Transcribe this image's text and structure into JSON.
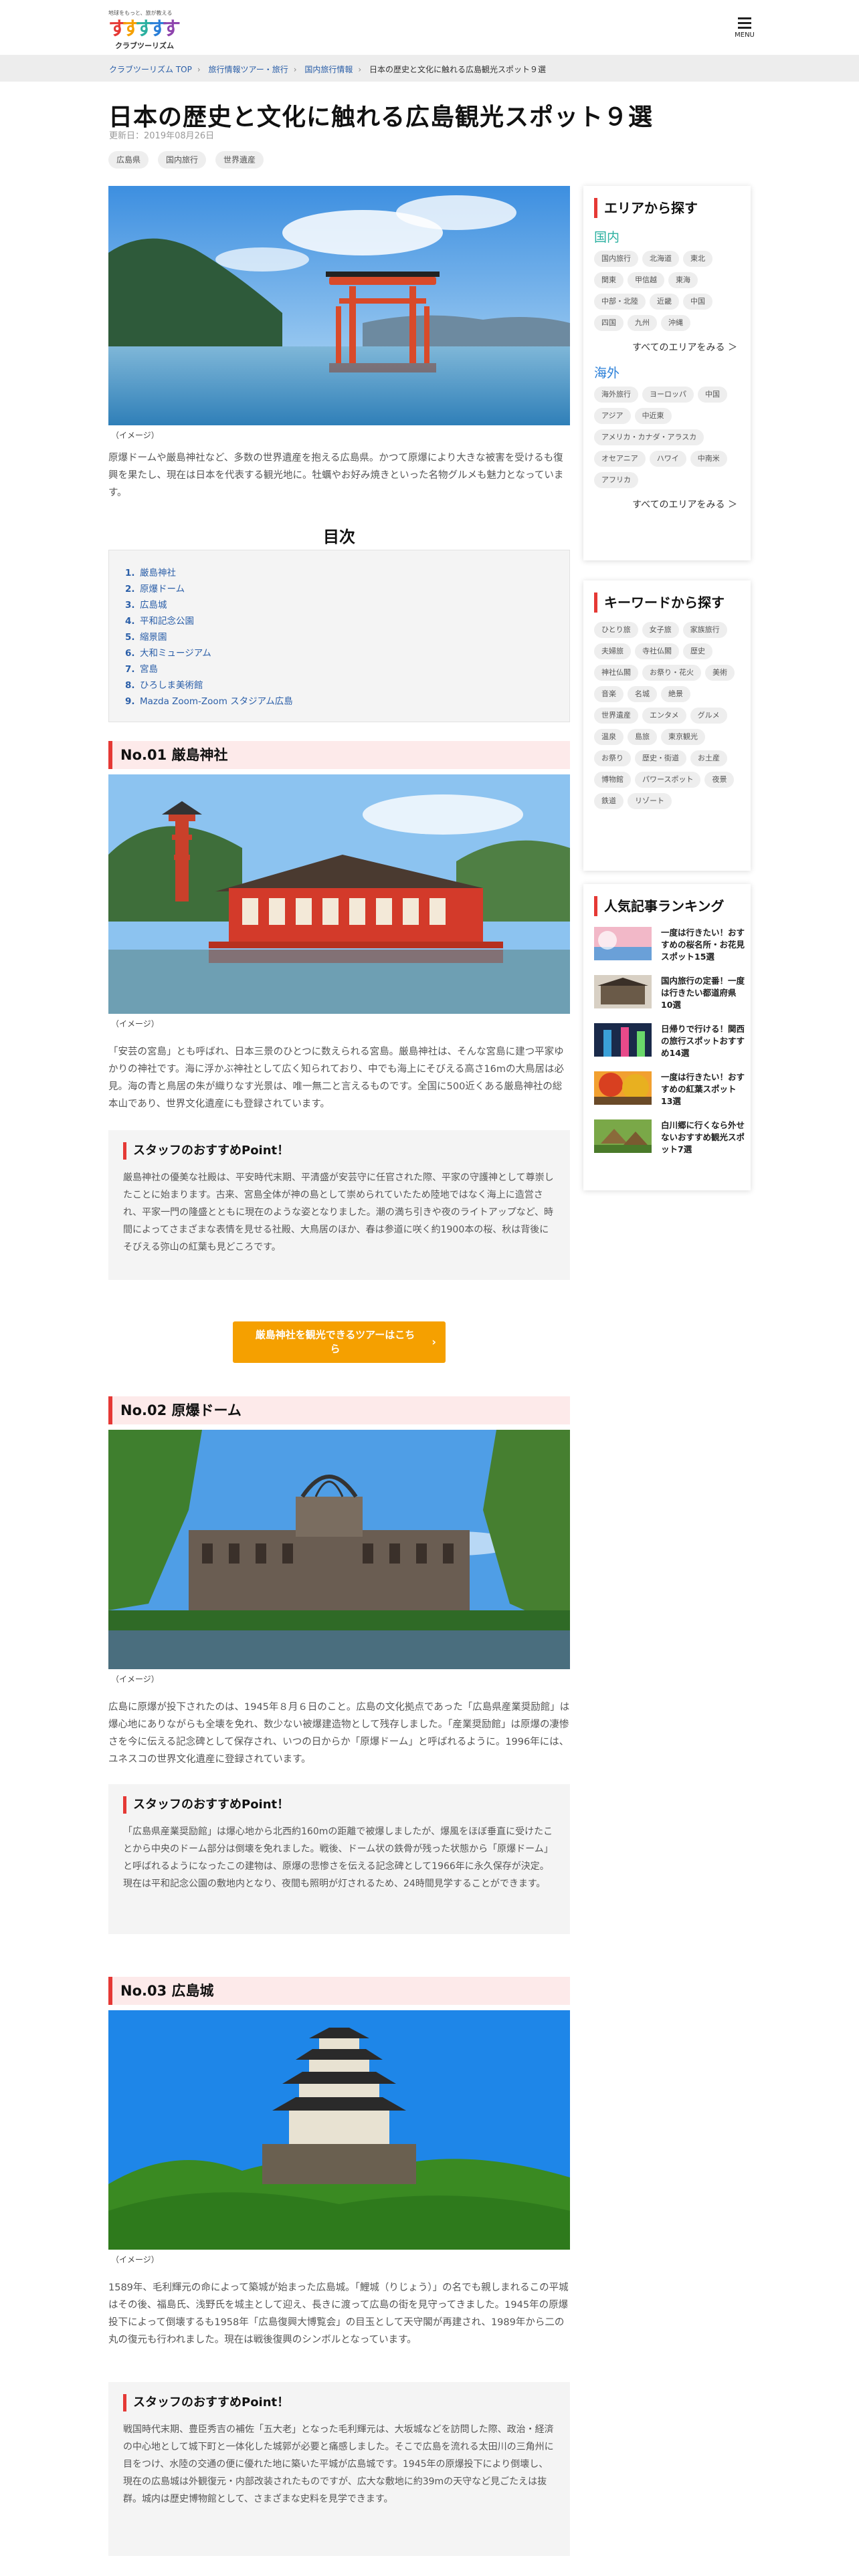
{
  "header": {
    "logo_tagline": "地球をもっと、旅が教える",
    "logo_name": "クラブツーリズム",
    "menu_label": "MENU"
  },
  "breadcrumb": [
    "クラブツーリズム TOP",
    "旅行情報ツアー・旅行",
    "国内旅行情報",
    "日本の歴史と文化に触れる広島観光スポット９選"
  ],
  "article": {
    "title": "日本の歴史と文化に触れる広島観光スポット９選",
    "updated": "更新日：2019年08月26日",
    "tags": [
      "広島県",
      "国内旅行",
      "世界遺産"
    ],
    "image_caption": "（イメージ）",
    "intro": "原爆ドームや厳島神社など、多数の世界遺産を抱える広島県。かつて原爆により大きな被害を受けるも復興を果たし、現在は日本を代表する観光地に。牡蠣やお好み焼きといった名物グルメも魅力となっています。",
    "toc_title": "目次",
    "toc": [
      "厳島神社",
      "原爆ドーム",
      "広島城",
      "平和記念公園",
      "縮景園",
      "大和ミュージアム",
      "宮島",
      "ひろしま美術館",
      "Mazda Zoom-Zoom スタジアム広島"
    ],
    "point_title": "スタッフのおすすめPoint！",
    "sections": [
      {
        "heading": "No.01 厳島神社",
        "caption": "（イメージ）",
        "body": "「安芸の宮島」とも呼ばれ、日本三景のひとつに数えられる宮島。厳島神社は、そんな宮島に建つ平家ゆかりの神社です。海に浮かぶ神社として広く知られており、中でも海上にそびえる高さ16mの大鳥居は必見。海の青と鳥居の朱が織りなす光景は、唯一無二と言えるものです。全国に500近くある厳島神社の総本山であり、世界文化遺産にも登録されています。",
        "point": "厳島神社の優美な社殿は、平安時代末期、平清盛が安芸守に任官された際、平家の守護神として尊崇したことに始まります。古来、宮島全体が神の島として崇められていたため陸地ではなく海上に造営され、平家一門の隆盛とともに現在のような姿となりました。潮の満ち引きや夜のライトアップなど、時間によってさまざまな表情を見せる社殿、大鳥居のほか、春は参道に咲く約1900本の桜、秋は背後にそびえる弥山の紅葉も見どころです。",
        "cta": "厳島神社を観光できるツアーはこちら"
      },
      {
        "heading": "No.02 原爆ドーム",
        "caption": "（イメージ）",
        "body": "広島に原爆が投下されたのは、1945年８月６日のこと。広島の文化拠点であった「広島県産業奨励館」は爆心地にありながらも全壊を免れ、数少ない被爆建造物として残存しました。「産業奨励館」は原爆の凄惨さを今に伝える記念碑として保存され、いつの日からか「原爆ドーム」と呼ばれるように。1996年には、ユネスコの世界文化遺産に登録されています。",
        "point": "「広島県産業奨励館」は爆心地から北西約160mの距離で被爆しましたが、爆風をほぼ垂直に受けたことから中央のドーム部分は倒壊を免れました。戦後、ドーム状の鉄骨が残った状態から「原爆ドーム」と呼ばれるようになったこの建物は、原爆の悲惨さを伝える記念碑として1966年に永久保存が決定。現在は平和記念公園の敷地内となり、夜間も照明が灯されるため、24時間見学することができます。"
      },
      {
        "heading": "No.03 広島城",
        "caption": "（イメージ）",
        "body": "1589年、毛利輝元の命によって築城が始まった広島城。「鯉城（りじょう）」の名でも親しまれるこの平城はその後、福島氏、浅野氏を城主として迎え、長きに渡って広島の街を見守ってきました。1945年の原爆投下によって倒壊するも1958年「広島復興大博覧会」の目玉として天守閣が再建され、1989年から二の丸の復元も行われました。現在は戦後復興のシンボルとなっています。",
        "point": "戦国時代末期、豊臣秀吉の補佐「五大老」となった毛利輝元は、大坂城などを訪問した際、政治・経済の中心地として城下町と一体化した城郭が必要と痛感しました。そこで広島を流れる太田川の三角州に目をつけ、水陸の交通の便に優れた地に築いた平城が広島城です。1945年の原爆投下により倒壊し、現在の広島城は外観復元・内部改装されたものですが、広大な敷地に約39mの天守など見ごたえは抜群。城内は歴史博物館として、さまざまな史料を見学できます。"
      }
    ]
  },
  "sidebar": {
    "area_title": "エリアから探す",
    "domestic_label": "国内",
    "domestic": [
      "国内旅行",
      "北海道",
      "東北",
      "関東",
      "甲信越",
      "東海",
      "中部・北陸",
      "近畿",
      "中国",
      "四国",
      "九州",
      "沖縄"
    ],
    "domestic_more": "すべてのエリアをみる ＞",
    "overseas_label": "海外",
    "overseas": [
      "海外旅行",
      "ヨーロッパ",
      "中国",
      "アジア",
      "中近東",
      "アメリカ・カナダ・アラスカ",
      "オセアニア",
      "ハワイ",
      "中南米",
      "アフリカ"
    ],
    "overseas_more": "すべてのエリアをみる ＞",
    "keyword_title": "キーワードから探す",
    "keywords": [
      "ひとり旅",
      "女子旅",
      "家族旅行",
      "夫婦旅",
      "寺社仏閣",
      "歴史",
      "神社仏閣",
      "お祭り・花火",
      "美術",
      "音楽",
      "名城",
      "絶景",
      "世界遺産",
      "エンタメ",
      "グルメ",
      "温泉",
      "島旅",
      "東京観光",
      "お祭り",
      "歴史・街道",
      "お土産",
      "博物館",
      "パワースポット",
      "夜景",
      "鉄道",
      "リゾート"
    ],
    "ranking_title": "人気記事ランキング",
    "ranking": [
      "一度は行きたい！おすすめの桜名所・お花見スポット15選",
      "国内旅行の定番！一度は行きたい都道府県10選",
      "日帰りで行ける！関西の旅行スポットおすすめ14選",
      "一度は行きたい！おすすめの紅葉スポット13選",
      "白川郷に行くなら外せないおすすめ観光スポット7選"
    ]
  }
}
